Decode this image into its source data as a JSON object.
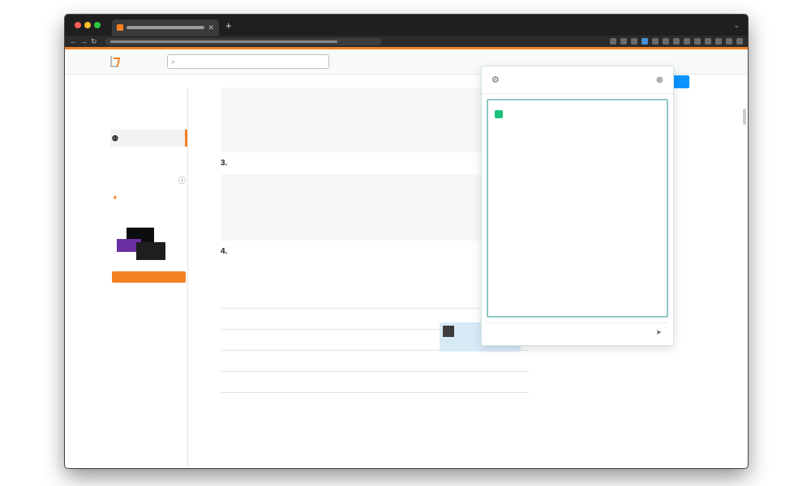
{
  "browser": {
    "tab_title": "",
    "url": ""
  },
  "so": {
    "logo_text": "",
    "nav": [
      "",
      "",
      ""
    ],
    "search_placeholder": "",
    "left_nav": {
      "home": "",
      "public": "",
      "questions": "",
      "tags": "",
      "users": "",
      "companies": "",
      "collectives": "",
      "explore_collectives": "",
      "teams_label": "",
      "teams_text": "",
      "teams_button": "",
      "teams_why": ""
    },
    "code1": [
      "",
      "",
      "",
      "",
      "",
      ""
    ],
    "section1_heading": "",
    "section1_text": "",
    "code2": [
      "",
      "",
      "",
      "",
      "",
      ""
    ],
    "section2_heading": "",
    "section2_text": "",
    "share_links": "",
    "edit_link": "",
    "user_name": "",
    "comments": [
      {
        "votes": "",
        "text": "",
        "link": "",
        "user": ""
      },
      {
        "votes": "",
        "text": "",
        "link": "",
        "user": ""
      },
      {
        "votes": "",
        "text": "",
        "link": "",
        "user": ""
      },
      {
        "votes": "",
        "text": "",
        "link": "",
        "user": ""
      },
      {
        "votes": "",
        "text": "",
        "link": "",
        "user": ""
      }
    ],
    "more_comments": ""
  },
  "popup": {
    "title": "",
    "paragraphs": [
      "",
      "",
      "",
      ""
    ],
    "input_placeholder": ""
  },
  "colors": {
    "accent": "#f48024",
    "link": "#0074cc",
    "popup_border": "#8fc9c4"
  }
}
